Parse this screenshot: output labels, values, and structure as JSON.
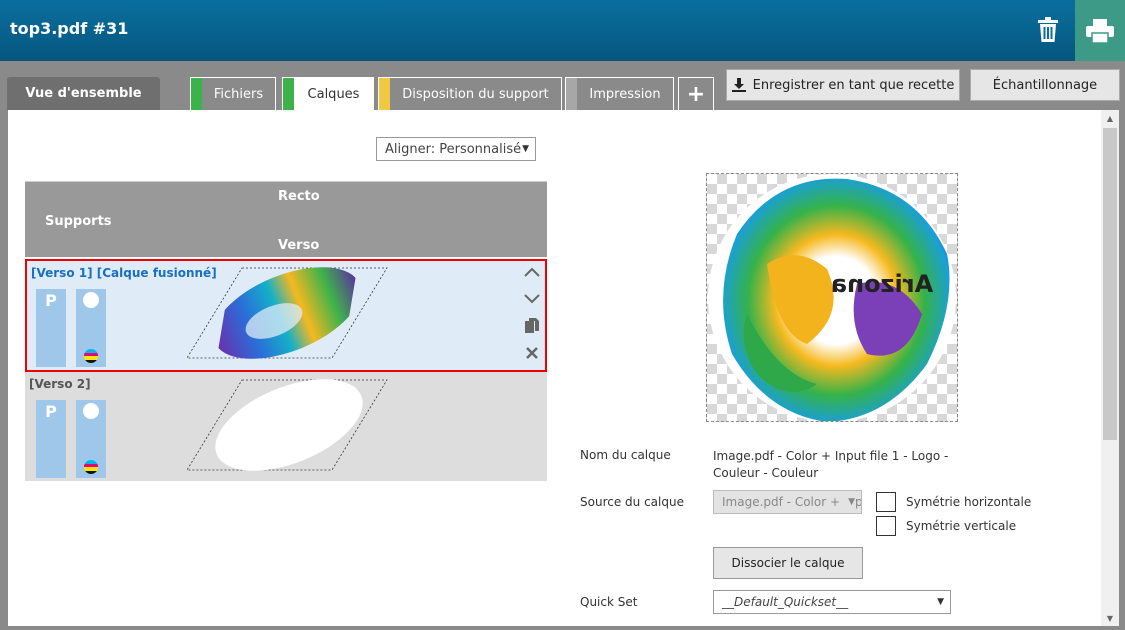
{
  "header": {
    "title": "top3.pdf #31",
    "trash_icon": "trash-icon",
    "print_icon": "printer-icon"
  },
  "tabs": {
    "overview": "Vue d'ensemble",
    "files": "Fichiers",
    "layers": "Calques",
    "layout": "Disposition du support",
    "print": "Impression",
    "add": "+",
    "colors": {
      "files": "#3cb34a",
      "layers": "#3cb34a",
      "layout": "#f2c842",
      "print": "#a7a7a7"
    }
  },
  "toolbar": {
    "save_recipe": "Enregistrer en tant que recette",
    "sampling": "Échantillonnage"
  },
  "align": {
    "value": "Aligner: Personnalisé"
  },
  "table": {
    "recto": "Recto",
    "supports": "Supports",
    "verso": "Verso"
  },
  "layers": [
    {
      "name": "[Verso 1] [Calque fusionné]",
      "chip_label": "P"
    },
    {
      "name": "[Verso 2]",
      "chip_label": "P"
    }
  ],
  "preview": {
    "logo_text": "Arizona"
  },
  "props": {
    "layer_name_label": "Nom du calque",
    "layer_name_value": "Image.pdf - Color + Input file 1 - Logo - Couleur - Couleur",
    "layer_source_label": "Source du calque",
    "layer_source_value": "Image.pdf - Color + Inp",
    "mirror_h": "Symétrie horizontale",
    "mirror_v": "Symétrie verticale",
    "dissociate": "Dissocier le calque",
    "quickset_label": "Quick Set",
    "quickset_value": "__Default_Quickset__"
  }
}
